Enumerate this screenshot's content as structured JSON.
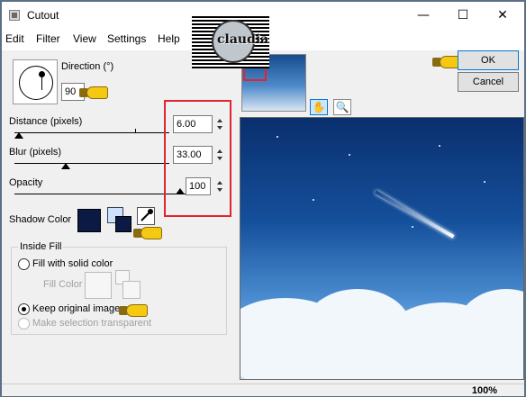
{
  "window": {
    "title": "Cutout",
    "minimize": "—",
    "maximize": "☐",
    "close": "✕"
  },
  "menu": {
    "edit": "Edit",
    "filter": "Filter",
    "view": "View",
    "settings": "Settings",
    "help": "Help"
  },
  "logo": {
    "text": "claudia"
  },
  "direction": {
    "label": "Direction (°)",
    "value": "90"
  },
  "distance": {
    "label": "Distance (pixels)",
    "value": "6.00",
    "level_fraction": 0.03
  },
  "blur": {
    "label": "Blur (pixels)",
    "value": "33.00",
    "level_fraction": 0.33
  },
  "opacity": {
    "label": "Opacity",
    "value": "100",
    "level_fraction": 1.0
  },
  "shadow_color": {
    "label": "Shadow Color",
    "color": "#0a1a44",
    "fg": "#0a1a44",
    "bg": "#d0e2fb"
  },
  "inside_fill": {
    "title": "Inside Fill",
    "fill_solid": "Fill with solid color",
    "fill_color": "Fill Color",
    "keep_original": "Keep original image",
    "make_transparent": "Make selection transparent",
    "selected": "keep_original"
  },
  "buttons": {
    "ok": "OK",
    "cancel": "Cancel"
  },
  "tools": {
    "pan": "✋",
    "zoom": "🔍"
  },
  "status": {
    "zoom": "100%"
  },
  "colors": {
    "highlight_border": "#e0262c",
    "accent": "#0078d7"
  }
}
